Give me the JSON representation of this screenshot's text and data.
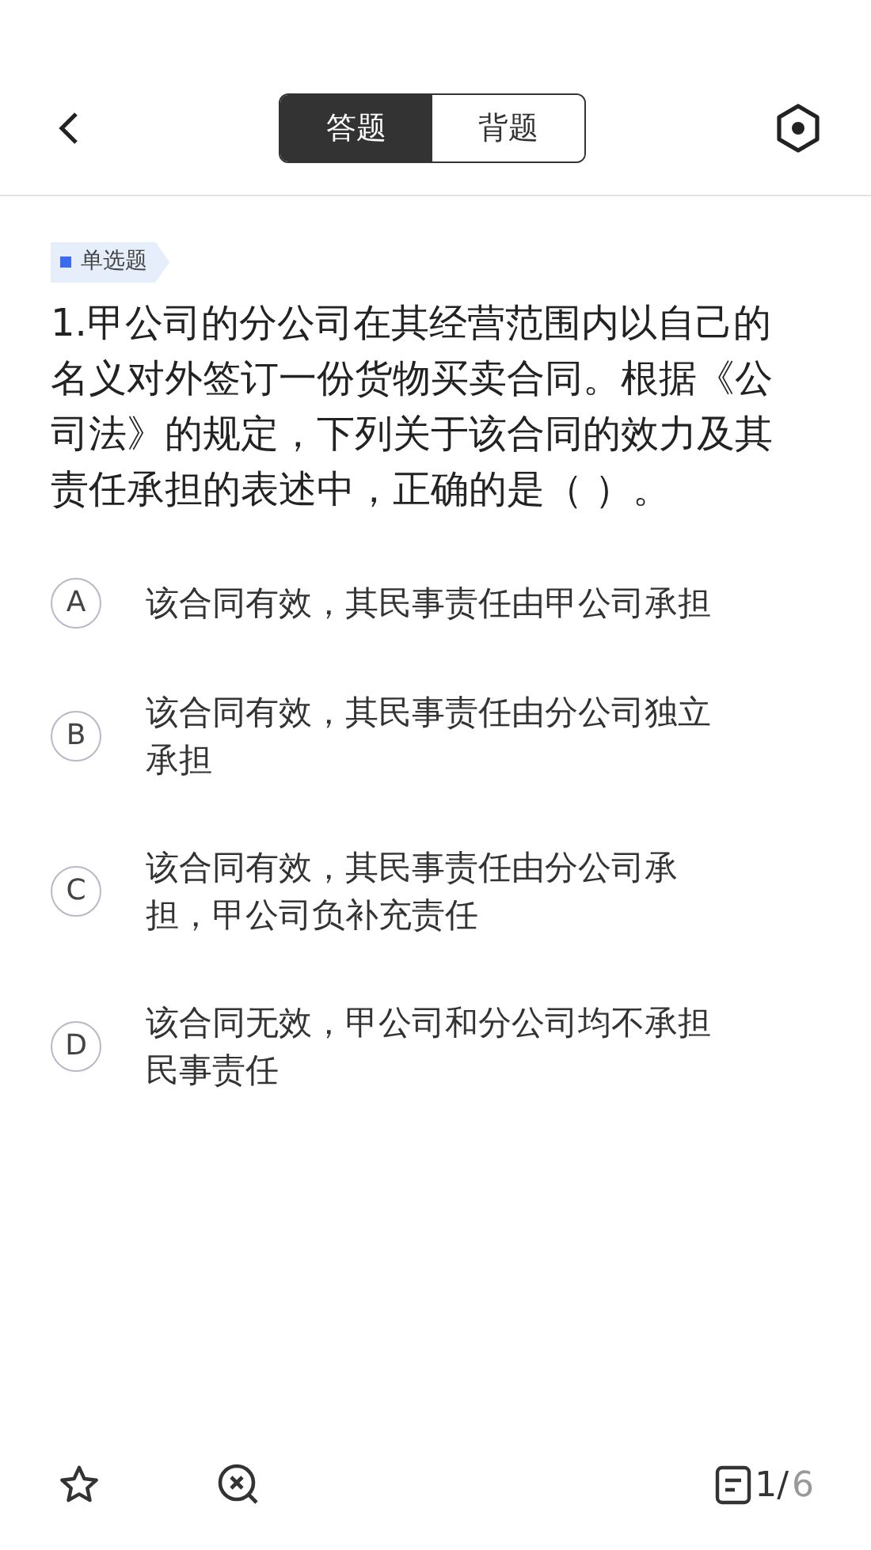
{
  "header": {
    "tabs": [
      {
        "label": "答题",
        "selected": true
      },
      {
        "label": "背题",
        "selected": false
      }
    ]
  },
  "question": {
    "type_tag": "单选题",
    "text": "1.甲公司的分公司在其经营范围内以自己的名义对外签订一份货物买卖合同。根据《公司法》的规定，下列关于该合同的效力及其责任承担的表述中，正确的是（ ）。"
  },
  "options": [
    {
      "letter": "A",
      "text": "该合同有效，其民事责任由甲公司承担",
      "selected": false
    },
    {
      "letter": "B",
      "text": "该合同有效，其民事责任由分公司独立承担",
      "selected": false
    },
    {
      "letter": "C",
      "text": "该合同有效，其民事责任由分公司承担，甲公司负补充责任",
      "selected": false
    },
    {
      "letter": "D",
      "text": "该合同无效，甲公司和分公司均不承担民事责任",
      "selected": false
    }
  ],
  "footer": {
    "current": "1",
    "separator": "/",
    "total": "6"
  }
}
